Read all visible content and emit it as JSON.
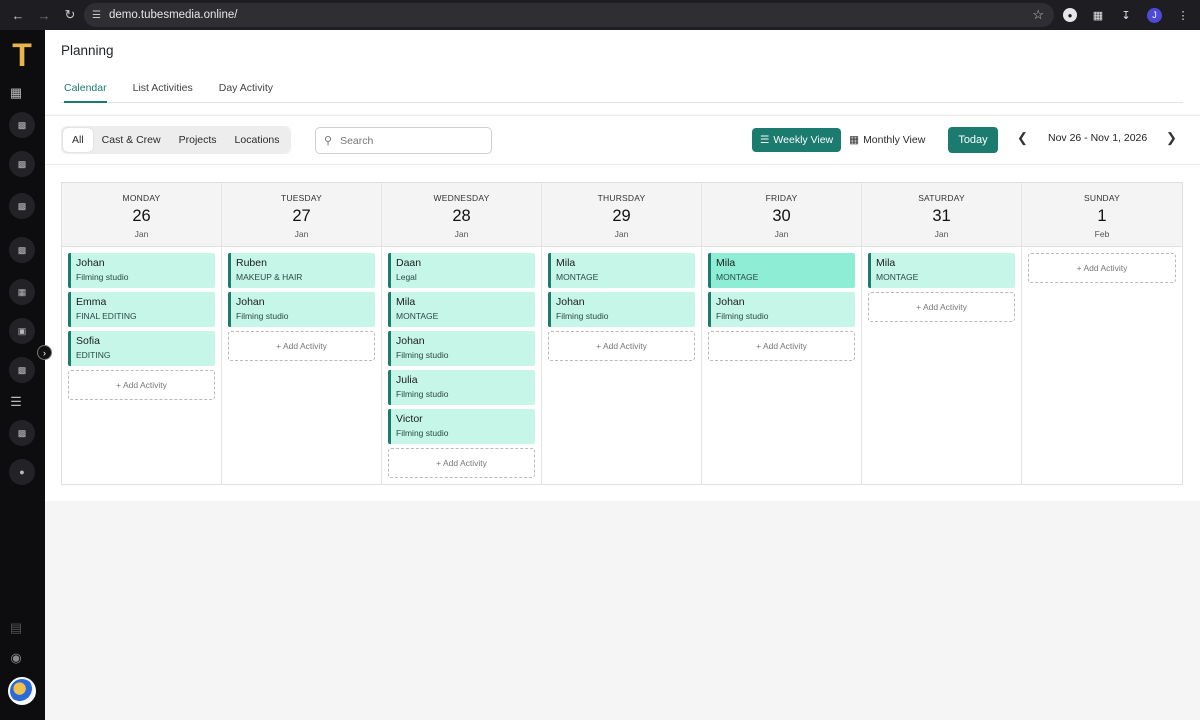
{
  "browser": {
    "url": "demo.tubesmedia.online/",
    "profile_initial": "J"
  },
  "sidebar": {
    "logo": "T",
    "collapse_icon": "chevron-right-icon"
  },
  "page": {
    "title": "Planning",
    "tabs": [
      {
        "label": "Calendar",
        "active": true
      },
      {
        "label": "List Activities",
        "active": false
      },
      {
        "label": "Day Activity",
        "active": false
      }
    ]
  },
  "toolbar": {
    "filters": [
      {
        "label": "All",
        "active": true
      },
      {
        "label": "Cast & Crew",
        "active": false
      },
      {
        "label": "Projects",
        "active": false
      },
      {
        "label": "Locations",
        "active": false
      }
    ],
    "search_placeholder": "Search",
    "weekly_view_label": "Weekly View",
    "monthly_view_label": "Monthly View",
    "today_label": "Today",
    "date_range": "Nov 26 - Nov 1, 2026"
  },
  "calendar": {
    "add_label": "+ Add Activity",
    "accent_color": "#1b7b6e",
    "days": [
      {
        "name": "MONDAY",
        "num": "26",
        "month": "Jan",
        "activities": [
          {
            "name": "Johan",
            "sub": "Filming studio"
          },
          {
            "name": "Emma",
            "sub": "FINAL EDITING"
          },
          {
            "name": "Sofia",
            "sub": "EDITING"
          }
        ]
      },
      {
        "name": "TUESDAY",
        "num": "27",
        "month": "Jan",
        "activities": [
          {
            "name": "Ruben",
            "sub": "MAKEUP & HAIR"
          },
          {
            "name": "Johan",
            "sub": "Filming studio"
          }
        ]
      },
      {
        "name": "WEDNESDAY",
        "num": "28",
        "month": "Jan",
        "activities": [
          {
            "name": "Daan",
            "sub": "Legal"
          },
          {
            "name": "Mila",
            "sub": "MONTAGE"
          },
          {
            "name": "Johan",
            "sub": "Filming studio"
          },
          {
            "name": "Julia",
            "sub": "Filming studio"
          },
          {
            "name": "Victor",
            "sub": "Filming studio"
          }
        ]
      },
      {
        "name": "THURSDAY",
        "num": "29",
        "month": "Jan",
        "activities": [
          {
            "name": "Mila",
            "sub": "MONTAGE"
          },
          {
            "name": "Johan",
            "sub": "Filming studio"
          }
        ]
      },
      {
        "name": "FRIDAY",
        "num": "30",
        "month": "Jan",
        "activities": [
          {
            "name": "Mila",
            "sub": "MONTAGE",
            "highlight": true
          },
          {
            "name": "Johan",
            "sub": "Filming studio"
          }
        ]
      },
      {
        "name": "SATURDAY",
        "num": "31",
        "month": "Jan",
        "activities": [
          {
            "name": "Mila",
            "sub": "MONTAGE"
          }
        ]
      },
      {
        "name": "SUNDAY",
        "num": "1",
        "month": "Feb",
        "activities": []
      }
    ]
  }
}
